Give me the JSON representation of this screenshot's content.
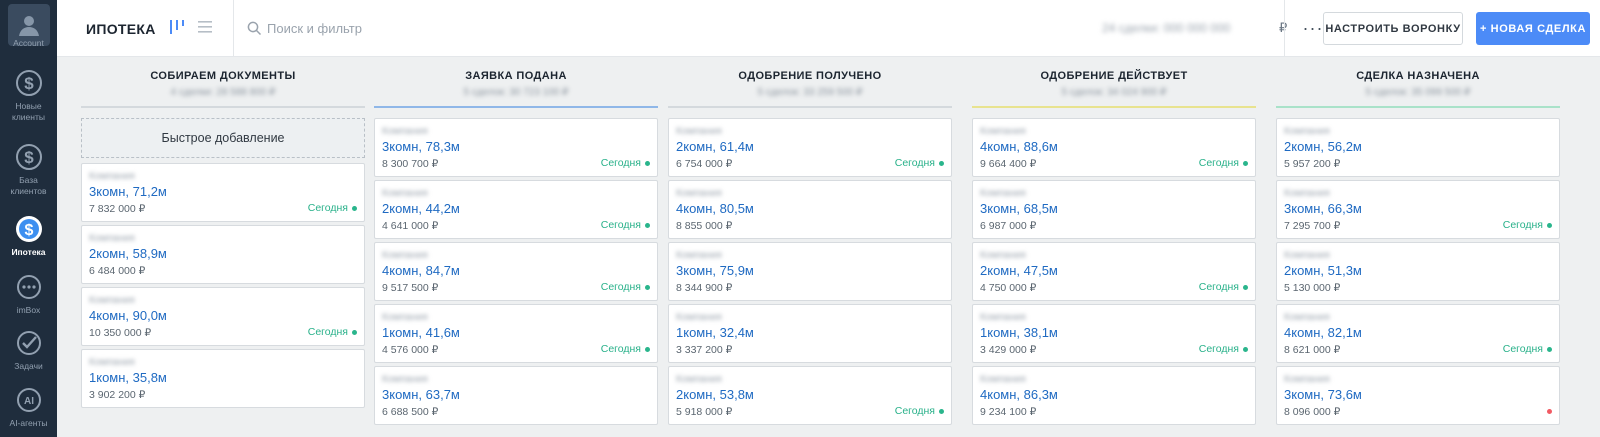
{
  "sidebar": {
    "items": [
      {
        "label": "Account",
        "icon": "account-avatar-icon"
      },
      {
        "label": "Новые клиенты",
        "icon": "dollar-icon"
      },
      {
        "label": "База клиентов",
        "icon": "dollar-icon"
      },
      {
        "label": "Ипотека",
        "icon": "dollar-icon"
      },
      {
        "label": "imBox",
        "icon": "chat-icon"
      },
      {
        "label": "Задачи",
        "icon": "check-icon"
      },
      {
        "label": "AI-агенты",
        "icon": "ai-icon"
      }
    ]
  },
  "header": {
    "title": "ИПОТЕКА",
    "search_placeholder": "Поиск и фильтр",
    "summary": "24 сделки: 000 000 000",
    "currency": "₽",
    "more": "···",
    "setup_label": "НАСТРОИТЬ ВОРОНКУ",
    "new_deal_label": "+ НОВАЯ СДЕЛКА"
  },
  "quick_add_label": "Быстрое добавление",
  "columns": [
    {
      "title": "СОБИРАЕМ ДОКУМЕНТЫ",
      "subtitle": "4 сделки: 28 588 800 ₽",
      "line_color": "#d4d9dd",
      "cards": [
        {
          "company": "Компания",
          "name": "3комн, 71,2м",
          "price": "7 832 000 ₽",
          "date": "Сегодня",
          "dot": "green"
        },
        {
          "company": "Компания",
          "name": "2комн, 58,9м",
          "price": "6 484 000 ₽",
          "date": "",
          "dot": ""
        },
        {
          "company": "Компания",
          "name": "4комн, 90,0м",
          "price": "10 350 000 ₽",
          "date": "Сегодня",
          "dot": "green"
        },
        {
          "company": "Компания",
          "name": "1комн, 35,8м",
          "price": "3 902 200 ₽",
          "date": "",
          "dot": ""
        }
      ]
    },
    {
      "title": "ЗАЯВКА ПОДАНА",
      "subtitle": "5 сделок: 30 723 100 ₽",
      "line_color": "#8fb7e8",
      "cards": [
        {
          "company": "Компания",
          "name": "3комн, 78,3м",
          "price": "8 300 700 ₽",
          "date": "Сегодня",
          "dot": "green"
        },
        {
          "company": "Компания",
          "name": "2комн, 44,2м",
          "price": "4 641 000 ₽",
          "date": "Сегодня",
          "dot": "green"
        },
        {
          "company": "Компания",
          "name": "4комн, 84,7м",
          "price": "9 517 500 ₽",
          "date": "Сегодня",
          "dot": "green"
        },
        {
          "company": "Компания",
          "name": "1комн, 41,6м",
          "price": "4 576 000 ₽",
          "date": "Сегодня",
          "dot": "green"
        },
        {
          "company": "Компания",
          "name": "3комн, 63,7м",
          "price": "6 688 500 ₽",
          "date": "",
          "dot": ""
        }
      ]
    },
    {
      "title": "ОДОБРЕНИЕ ПОЛУЧЕНО",
      "subtitle": "5 сделок: 33 259 500 ₽",
      "line_color": "#d4d9dd",
      "cards": [
        {
          "company": "Компания",
          "name": "2комн, 61,4м",
          "price": "6 754 000 ₽",
          "date": "Сегодня",
          "dot": "green"
        },
        {
          "company": "Компания",
          "name": "4комн, 80,5м",
          "price": "8 855 000 ₽",
          "date": "",
          "dot": ""
        },
        {
          "company": "Компания",
          "name": "3комн, 75,9м",
          "price": "8 344 900 ₽",
          "date": "",
          "dot": ""
        },
        {
          "company": "Компания",
          "name": "1комн, 32,4м",
          "price": "3 337 200 ₽",
          "date": "",
          "dot": ""
        },
        {
          "company": "Компания",
          "name": "2комн, 53,8м",
          "price": "5 918 000 ₽",
          "date": "Сегодня",
          "dot": "green"
        }
      ]
    },
    {
      "title": "ОДОБРЕНИЕ ДЕЙСТВУЕТ",
      "subtitle": "5 сделок: 34 024 900 ₽",
      "line_color": "#e8e38f",
      "cards": [
        {
          "company": "Компания",
          "name": "4комн, 88,6м",
          "price": "9 664 400 ₽",
          "date": "Сегодня",
          "dot": "green"
        },
        {
          "company": "Компания",
          "name": "3комн, 68,5м",
          "price": "6 987 000 ₽",
          "date": "",
          "dot": ""
        },
        {
          "company": "Компания",
          "name": "2комн, 47,5м",
          "price": "4 750 000 ₽",
          "date": "Сегодня",
          "dot": "green"
        },
        {
          "company": "Компания",
          "name": "1комн, 38,1м",
          "price": "3 429 000 ₽",
          "date": "Сегодня",
          "dot": "green"
        },
        {
          "company": "Компания",
          "name": "4комн, 86,3м",
          "price": "9 234 100 ₽",
          "date": "",
          "dot": ""
        }
      ]
    },
    {
      "title": "СДЕЛКА НАЗНАЧЕНА",
      "subtitle": "5 сделок: 35 099 500 ₽",
      "line_color": "#a9e2c9",
      "cards": [
        {
          "company": "Компания",
          "name": "2комн, 56,2м",
          "price": "5 957 200 ₽",
          "date": "",
          "dot": ""
        },
        {
          "company": "Компания",
          "name": "3комн, 66,3м",
          "price": "7 295 700 ₽",
          "date": "Сегодня",
          "dot": "green"
        },
        {
          "company": "Компания",
          "name": "2комн, 51,3м",
          "price": "5 130 000 ₽",
          "date": "",
          "dot": ""
        },
        {
          "company": "Компания",
          "name": "4комн, 82,1м",
          "price": "8 621 000 ₽",
          "date": "Сегодня",
          "dot": "green"
        },
        {
          "company": "Компания",
          "name": "3комн, 73,6м",
          "price": "8 096 000 ₽",
          "date": "",
          "dot": "red"
        }
      ]
    }
  ]
}
